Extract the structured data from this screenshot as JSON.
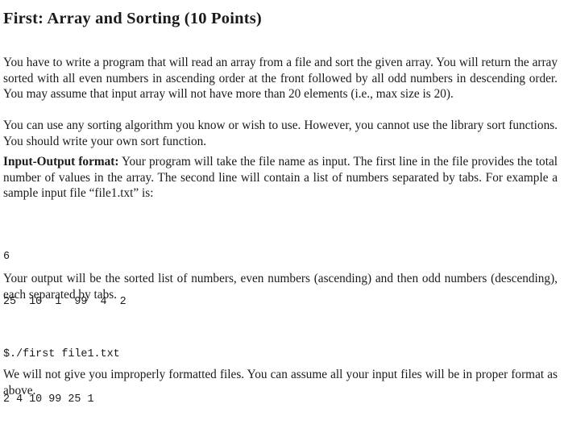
{
  "heading": "First: Array and Sorting (10 Points)",
  "paragraphs": {
    "intro": "You have to write a program that will read an array from a file and sort the given array. You will return the array sorted with all even numbers in ascending order at the front followed by all odd numbers in descending order. You may assume that input array will not have more than 20 elements (i.e., max size is 20).",
    "algorithm": "You can use any sorting algorithm you know or wish to use. However, you cannot use the library sort functions. You should write your own sort function.",
    "format_label": "Input-Output format:",
    "format_text": " Your program will take the file name as input. The first line in the file provides the total number of values in the array. The second line will contain a list of numbers separated by tabs. For example a sample input file “file1.txt” is:",
    "output": "Your output will be the sorted list of numbers, even numbers (ascending) and then odd numbers (descending), each separated by tabs.",
    "closing": "We will not give you improperly formatted files. You can assume all your input files will be in proper format as above."
  },
  "sample_input": {
    "lines": [
      "6",
      "25  10  1  99  4  2"
    ]
  },
  "sample_output": {
    "lines": [
      "$./first file1.txt",
      "2 4 10 99 25 1"
    ]
  }
}
